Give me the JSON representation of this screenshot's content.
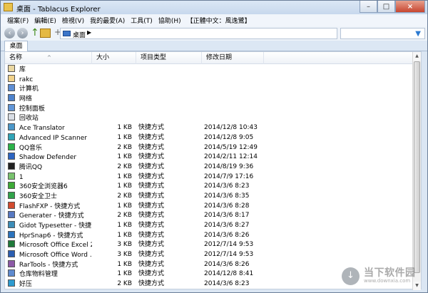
{
  "window": {
    "title": "桌面 - Tablacus Explorer",
    "minimize": "–",
    "maximize": "□",
    "close": "×"
  },
  "menu": [
    "檔案(F)",
    "編輯(E)",
    "檢視(V)",
    "我的最愛(A)",
    "工具(T)",
    "協助(H)",
    "【正體中文：風逸鷺】"
  ],
  "toolbar": {
    "back": "‹",
    "forward": "›",
    "up": "↑",
    "plus": "+",
    "address": "桌面",
    "address_arrow": "▶"
  },
  "tabs": {
    "active": "桌面"
  },
  "columns": {
    "name": "名称",
    "size": "大小",
    "type": "项目类型",
    "date": "修改日期",
    "sort_indicator": "^"
  },
  "files": [
    {
      "name": "库",
      "size": "",
      "type": "",
      "date": "",
      "icon": "library-icon",
      "color": "#ead7a1"
    },
    {
      "name": "rakc",
      "size": "",
      "type": "",
      "date": "",
      "icon": "user-folder-icon",
      "color": "#f2d28a"
    },
    {
      "name": "计算机",
      "size": "",
      "type": "",
      "date": "",
      "icon": "computer-icon",
      "color": "#5e8ed4"
    },
    {
      "name": "网络",
      "size": "",
      "type": "",
      "date": "",
      "icon": "network-icon",
      "color": "#4d82cc"
    },
    {
      "name": "控制面板",
      "size": "",
      "type": "",
      "date": "",
      "icon": "control-panel-icon",
      "color": "#6196d8"
    },
    {
      "name": "回收站",
      "size": "",
      "type": "",
      "date": "",
      "icon": "recycle-bin-icon",
      "color": "#d8dde4"
    },
    {
      "name": "Ace Translator",
      "size": "1 KB",
      "type": "快捷方式",
      "date": "2014/12/8 10:43",
      "icon": "globe-icon",
      "color": "#4b97c9"
    },
    {
      "name": "Advanced IP Scanner",
      "size": "1 KB",
      "type": "快捷方式",
      "date": "2014/12/8 9:05",
      "icon": "scanner-icon",
      "color": "#30a4b7"
    },
    {
      "name": "QQ音乐",
      "size": "2 KB",
      "type": "快捷方式",
      "date": "2014/5/19 12:49",
      "icon": "music-icon",
      "color": "#2cb34a"
    },
    {
      "name": "Shadow Defender",
      "size": "1 KB",
      "type": "快捷方式",
      "date": "2014/2/11 12:14",
      "icon": "shield-icon",
      "color": "#2d65c2"
    },
    {
      "name": "腾讯QQ",
      "size": "2 KB",
      "type": "快捷方式",
      "date": "2014/8/19 9:36",
      "icon": "penguin-icon",
      "color": "#222222"
    },
    {
      "name": "1",
      "size": "1 KB",
      "type": "快捷方式",
      "date": "2014/7/9 17:16",
      "icon": "shortcut-icon",
      "color": "#79c36e"
    },
    {
      "name": "360安全浏览器6",
      "size": "1 KB",
      "type": "快捷方式",
      "date": "2014/3/6 8:23",
      "icon": "browser-icon",
      "color": "#3daa36"
    },
    {
      "name": "360安全卫士",
      "size": "2 KB",
      "type": "快捷方式",
      "date": "2014/3/6 8:35",
      "icon": "security-icon",
      "color": "#31a34a"
    },
    {
      "name": "FlashFXP - 快捷方式",
      "size": "1 KB",
      "type": "快捷方式",
      "date": "2014/3/6 8:28",
      "icon": "ftp-icon",
      "color": "#d24b2f"
    },
    {
      "name": "Generater - 快捷方式",
      "size": "2 KB",
      "type": "快捷方式",
      "date": "2014/3/6 8:17",
      "icon": "generator-icon",
      "color": "#5779c2"
    },
    {
      "name": "Gidot Typesetter - 快捷...",
      "size": "1 KB",
      "type": "快捷方式",
      "date": "2014/3/6 8:27",
      "icon": "typesetter-icon",
      "color": "#3c8db8"
    },
    {
      "name": "HprSnap6 - 快捷方式",
      "size": "1 KB",
      "type": "快捷方式",
      "date": "2014/3/6 8:26",
      "icon": "camera-icon",
      "color": "#2b73bd"
    },
    {
      "name": "Microsoft Office Excel 2...",
      "size": "3 KB",
      "type": "快捷方式",
      "date": "2012/7/14 9:53",
      "icon": "excel-icon",
      "color": "#1f7a3a"
    },
    {
      "name": "Microsoft Office Word ...",
      "size": "3 KB",
      "type": "快捷方式",
      "date": "2012/7/14 9:53",
      "icon": "word-icon",
      "color": "#2b5eb1"
    },
    {
      "name": "RarTools - 快捷方式",
      "size": "1 KB",
      "type": "快捷方式",
      "date": "2014/3/6 8:26",
      "icon": "archive-icon",
      "color": "#8d5aa7"
    },
    {
      "name": "仓库物料管理",
      "size": "1 KB",
      "type": "快捷方式",
      "date": "2014/12/8 8:41",
      "icon": "warehouse-icon",
      "color": "#5f8bd0"
    },
    {
      "name": "好压",
      "size": "2 KB",
      "type": "快捷方式",
      "date": "2014/3/6 8:23",
      "icon": "compress-icon",
      "color": "#2d9bd0"
    }
  ],
  "watermark": {
    "main": "当下软件园",
    "sub": "www.downxia.com",
    "icon": "↓"
  }
}
